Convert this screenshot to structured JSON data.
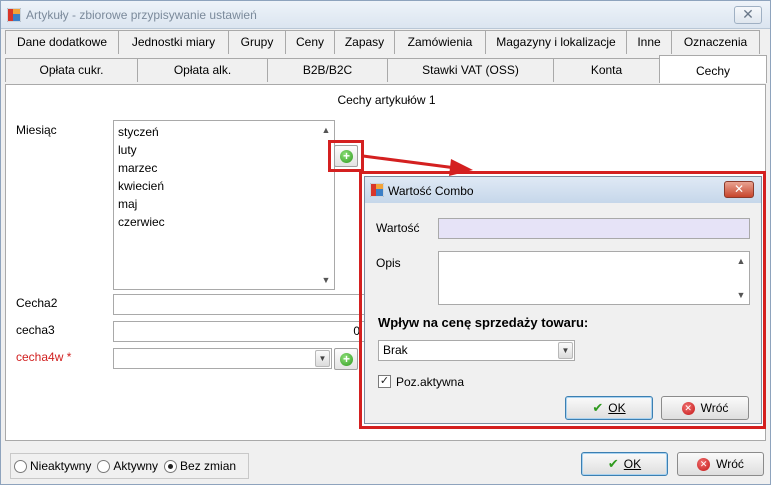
{
  "window": {
    "title": "Artykuły - zbiorowe przypisywanie ustawień",
    "close": "✕"
  },
  "tabs_row1": [
    {
      "label": "Dane dodatkowe"
    },
    {
      "label": "Jednostki miary"
    },
    {
      "label": "Grupy"
    },
    {
      "label": "Ceny"
    },
    {
      "label": "Zapasy"
    },
    {
      "label": "Zamówienia"
    },
    {
      "label": "Magazyny i lokalizacje"
    },
    {
      "label": "Inne"
    },
    {
      "label": "Oznaczenia"
    }
  ],
  "tabs_row2": [
    {
      "label": "Opłata cukr."
    },
    {
      "label": "Opłata alk."
    },
    {
      "label": "B2B/B2C"
    },
    {
      "label": "Stawki VAT (OSS)"
    },
    {
      "label": "Konta"
    },
    {
      "label": "Cechy"
    }
  ],
  "panel": {
    "group_title": "Cechy artykułów 1",
    "miesiac": {
      "label": "Miesiąc",
      "items": [
        "styczeń",
        "luty",
        "marzec",
        "kwiecień",
        "maj",
        "czerwiec"
      ]
    },
    "cecha2": {
      "label": "Cecha2",
      "value": ""
    },
    "cecha3": {
      "label": "cecha3",
      "value": "0"
    },
    "cecha4w": {
      "label": "cecha4w *",
      "value": ""
    }
  },
  "bottom": {
    "radios": [
      {
        "label": "Nieaktywny",
        "checked": false
      },
      {
        "label": "Aktywny",
        "checked": false
      },
      {
        "label": "Bez zmian",
        "checked": true
      }
    ],
    "ok_label": "OK",
    "back_label": "Wróć"
  },
  "dialog": {
    "title": "Wartość Combo",
    "close": "✕",
    "wartosc_label": "Wartość",
    "wartosc_value": "",
    "opis_label": "Opis",
    "opis_value": "",
    "section_label": "Wpływ na cenę sprzedaży towaru:",
    "combo_value": "Brak",
    "checkbox_label": "Poz.aktywna",
    "checkbox_checked": true,
    "ok_label": "OK",
    "back_label": "Wróć"
  },
  "colors": {
    "highlight": "#d42020",
    "input_highlight": "#e6e3f7",
    "required_label": "#d11f1f"
  }
}
